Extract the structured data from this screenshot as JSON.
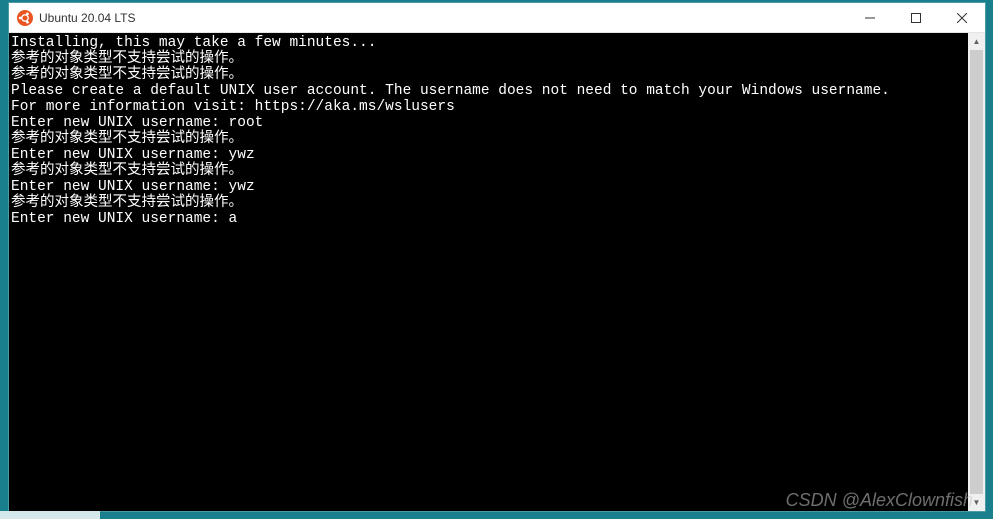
{
  "window": {
    "title": "Ubuntu 20.04 LTS"
  },
  "terminal": {
    "lines": [
      "Installing, this may take a few minutes...",
      "参考的对象类型不支持尝试的操作。",
      "参考的对象类型不支持尝试的操作。",
      "Please create a default UNIX user account. The username does not need to match your Windows username.",
      "For more information visit: https://aka.ms/wslusers",
      "Enter new UNIX username: root",
      "参考的对象类型不支持尝试的操作。",
      "Enter new UNIX username: ywz",
      "参考的对象类型不支持尝试的操作。",
      "Enter new UNIX username: ywz",
      "参考的对象类型不支持尝试的操作。"
    ],
    "current_prompt": "Enter new UNIX username: ",
    "current_input": "a"
  },
  "watermark": "CSDN @AlexClownfish"
}
